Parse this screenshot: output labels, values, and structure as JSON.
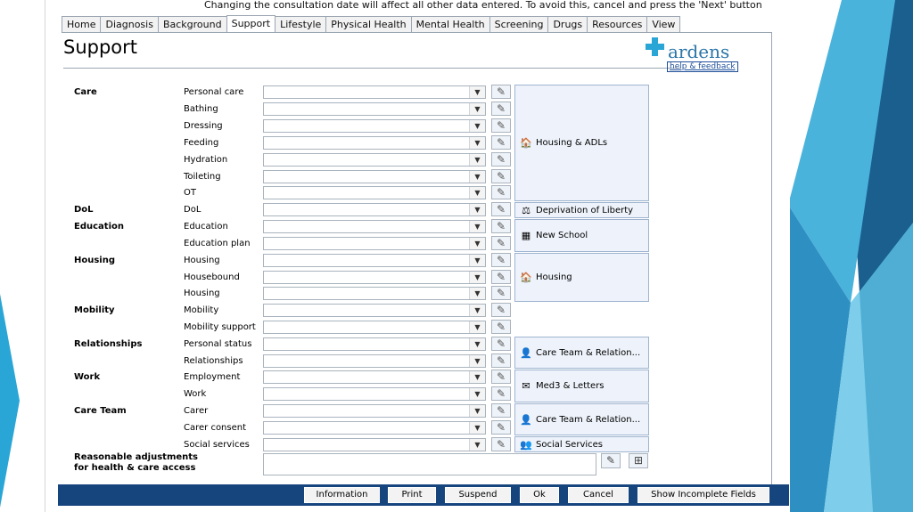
{
  "notice": "Changing the consultation date will affect all other data entered. To avoid this, cancel and press the 'Next' button",
  "tabs": [
    "Home",
    "Diagnosis",
    "Background",
    "Support",
    "Lifestyle",
    "Physical Health",
    "Mental Health",
    "Screening",
    "Drugs",
    "Resources",
    "View"
  ],
  "active_tab": "Support",
  "page_title": "Support",
  "logo": {
    "name": "ardens",
    "link": "help & feedback"
  },
  "sections": [
    {
      "label": "Care",
      "rows": [
        "Personal care",
        "Bathing",
        "Dressing",
        "Feeding",
        "Hydration",
        "Toileting",
        "OT"
      ]
    },
    {
      "label": "DoL",
      "rows": [
        "DoL"
      ]
    },
    {
      "label": "Education",
      "rows": [
        "Education",
        "Education plan"
      ]
    },
    {
      "label": "Housing",
      "rows": [
        "Housing",
        "Housebound",
        "Housing"
      ]
    },
    {
      "label": "Mobility",
      "rows": [
        "Mobility",
        "Mobility support"
      ]
    },
    {
      "label": "Relationships",
      "rows": [
        "Personal status",
        "Relationships"
      ]
    },
    {
      "label": "Work",
      "rows": [
        "Employment",
        "Work"
      ]
    },
    {
      "label": "Care Team",
      "rows": [
        "Carer",
        "Carer consent",
        "Social services"
      ]
    }
  ],
  "panels": [
    {
      "label": "Housing & ADLs",
      "icon": "house-icon"
    },
    {
      "label": "Deprivation of Liberty",
      "icon": "scales-icon"
    },
    {
      "label": "New School",
      "icon": "school-icon"
    },
    {
      "label": "Housing",
      "icon": "house-icon"
    },
    {
      "label": "Care Team & Relation...",
      "icon": "person-icon"
    },
    {
      "label": "Med3 & Letters",
      "icon": "letter-icon"
    },
    {
      "label": "Care Team & Relation...",
      "icon": "person-icon"
    },
    {
      "label": "Social Services",
      "icon": "group-icon"
    }
  ],
  "adjustments_label_line1": "Reasonable adjustments",
  "adjustments_label_line2": "for health & care access",
  "buttons": {
    "information": "Information",
    "print": "Print",
    "suspend": "Suspend",
    "ok": "Ok",
    "cancel": "Cancel",
    "show_incomplete": "Show Incomplete Fields"
  },
  "colors": {
    "accent": "#2aa6d6",
    "bottom_bar": "#16457e",
    "panel_bg": "#eef3fb"
  }
}
